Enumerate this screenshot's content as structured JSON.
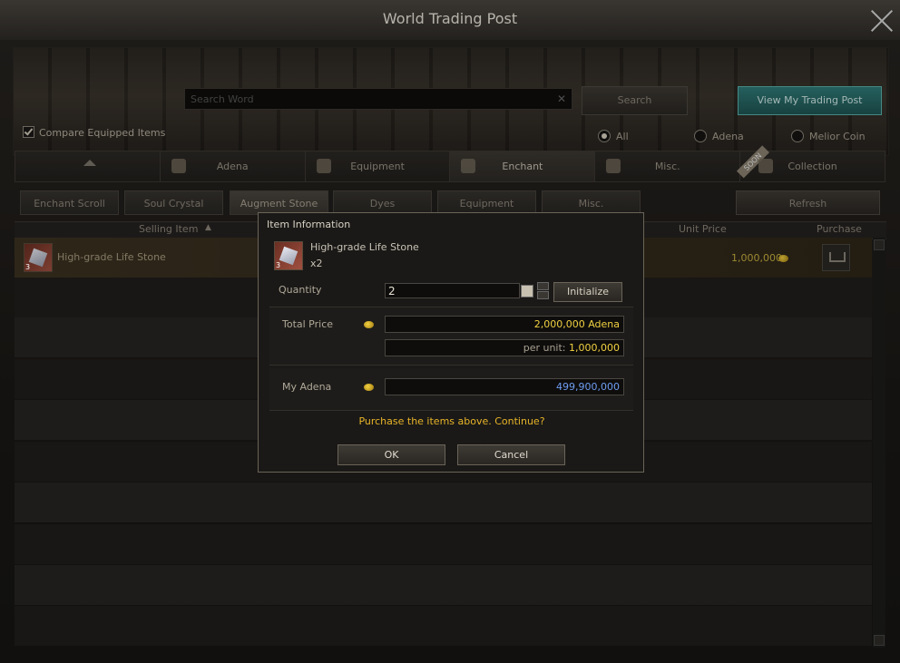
{
  "window": {
    "title": "World Trading Post"
  },
  "search": {
    "placeholder": "Search Word",
    "clear_glyph": "✕",
    "button": "Search"
  },
  "my_post_button": "View My Trading Post",
  "compare_label": "Compare Equipped Items",
  "currency_filter": {
    "options": [
      "All",
      "Adena",
      "Melior Coin"
    ],
    "selected": "All"
  },
  "categories": [
    {
      "label": "",
      "icon": "home-icon"
    },
    {
      "label": "Adena",
      "icon": "adena-icon"
    },
    {
      "label": "Equipment",
      "icon": "equipment-icon"
    },
    {
      "label": "Enchant",
      "icon": "enchant-icon",
      "active": true
    },
    {
      "label": "Misc.",
      "icon": "misc-icon"
    },
    {
      "label": "Collection",
      "icon": "collection-icon",
      "badge": "SOON"
    }
  ],
  "subtabs": [
    "Enchant Scroll",
    "Soul Crystal",
    "Augment Stone",
    "Dyes",
    "Equipment",
    "Misc."
  ],
  "active_subtab": "Augment Stone",
  "refresh_button": "Refresh",
  "table": {
    "headers": {
      "selling_item": "Selling Item",
      "sort_glyph": "▲",
      "unit_price": "Unit Price",
      "purchase": "Purchase"
    },
    "rows": [
      {
        "item": "High-grade Life Stone",
        "count": "3",
        "unit_price": "1,000,000"
      }
    ]
  },
  "dialog": {
    "title": "Item Information",
    "item_name": "High-grade Life Stone",
    "item_count": "3",
    "quantity_text": "x2",
    "quantity_label": "Quantity",
    "quantity_value": "2",
    "initialize_button": "Initialize",
    "total_price_label": "Total Price",
    "total_price_value": "2,000,000 Adena",
    "per_unit_label": "per unit:",
    "per_unit_value": "1,000,000",
    "my_adena_label": "My Adena",
    "my_adena_value": "499,900,000",
    "confirm_text": "Purchase the items above. Continue?",
    "ok_button": "OK",
    "cancel_button": "Cancel"
  },
  "colors": {
    "accent_teal": "#2f7a78",
    "price_yellow": "#f0d040",
    "adena_blue": "#6e9cf0",
    "confirm_text": "#e8b428"
  }
}
